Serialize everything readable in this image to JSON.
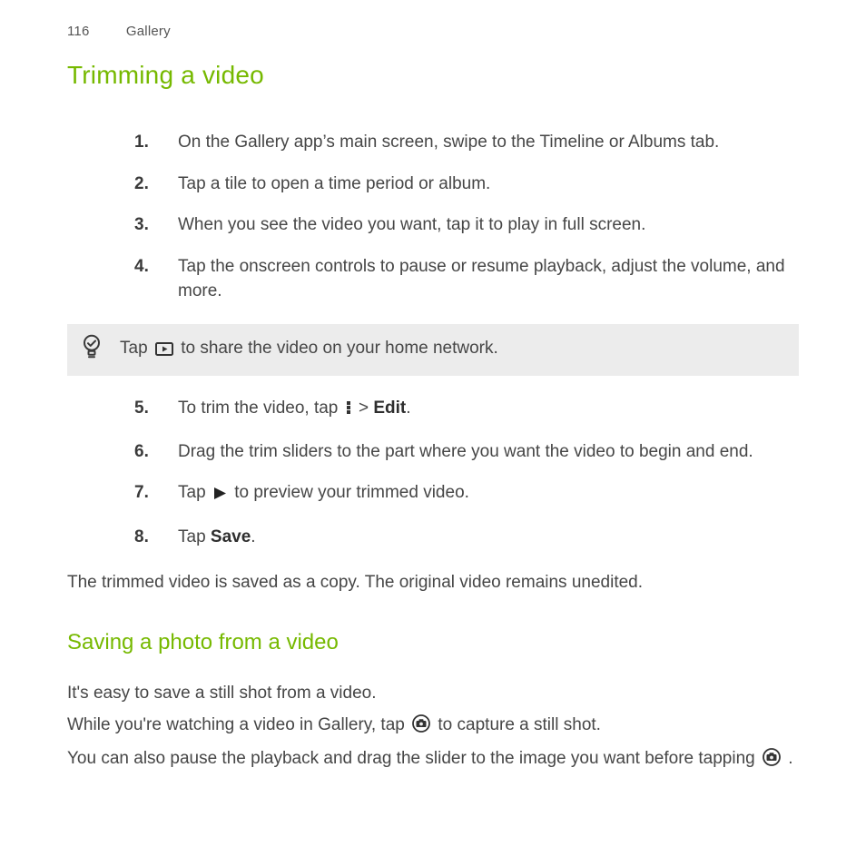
{
  "header": {
    "page_number": "116",
    "chapter": "Gallery"
  },
  "section1": {
    "title": "Trimming a video",
    "steps_a": [
      "On the Gallery app’s main screen, swipe to the Timeline or Albums tab.",
      "Tap a tile to open a time period or album.",
      "When you see the video you want, tap it to play in full screen.",
      "Tap the onscreen controls to pause or resume playback, adjust the volume, and more."
    ],
    "tip": {
      "pre": "Tap ",
      "post": " to share the video on your home network."
    },
    "step5": {
      "pre": "To trim the video, tap ",
      "mid": " > ",
      "edit": "Edit",
      "post": "."
    },
    "step6": "Drag the trim sliders to the part where you want the video to begin and end.",
    "step7": {
      "pre": "Tap ",
      "post": " to preview your trimmed video."
    },
    "step8": {
      "pre": "Tap ",
      "save": "Save",
      "post": "."
    },
    "footer": "The trimmed video is saved as a copy. The original video remains unedited."
  },
  "section2": {
    "title": "Saving a photo from a video",
    "p1": "It's easy to save a still shot from a video.",
    "p2": {
      "pre": "While you're watching a video in Gallery, tap ",
      "post": " to capture a still shot."
    },
    "p3": {
      "pre": "You can also pause the playback and drag the slider to the image you want before tapping ",
      "post": "."
    }
  },
  "nums": {
    "1": "1.",
    "2": "2.",
    "3": "3.",
    "4": "4.",
    "5": "5.",
    "6": "6.",
    "7": "7.",
    "8": "8."
  }
}
